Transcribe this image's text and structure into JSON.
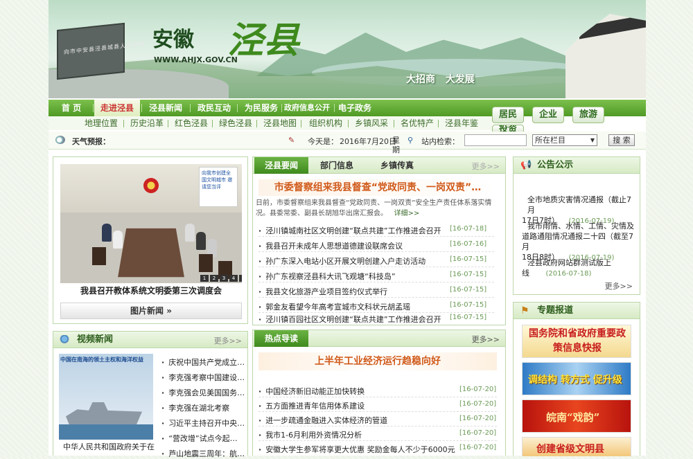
{
  "banner": {
    "title_a": "安徽",
    "title_b": "泾县",
    "url": "WWW.AHJX.GOV.CN",
    "slogan": "大招商 大发展",
    "monument_text": "向市中安县泾县城县人民政府"
  },
  "nav": {
    "main": [
      "首 页",
      "走进泾县",
      "泾县新闻",
      "政民互动",
      "为民服务",
      "政府信息公开",
      "电子政务"
    ],
    "current": "走进泾县",
    "sub": [
      "地理位置",
      "历史沿革",
      "红色泾县",
      "绿色泾县",
      "泾县地图",
      "组织机构",
      "乡镇风采",
      "名优特产",
      "泾县年鉴"
    ],
    "buttons": [
      "居民",
      "企业",
      "旅游",
      "投资"
    ]
  },
  "toolbar": {
    "weather_label": "天气预报：",
    "today_label": "今天是：",
    "date": "2016年7月20日",
    "weekday": "星期三",
    "search_label": "站内检索：",
    "search_scope": "所在栏目",
    "search_button": "搜 索"
  },
  "photo_news": {
    "wall_banner": "向我市创建全国文明城市 邀请您当评",
    "caption": "我县召开教体系统文明委第三次调度会",
    "pages": [
      "1",
      "2",
      "3",
      "4",
      "5"
    ],
    "button": "图片新闻"
  },
  "video": {
    "title": "视频新闻",
    "more": "更多>>",
    "image_title": "中国在南海的领土主权和海洋权益",
    "image_caption": "中华人民共和国政府关于在",
    "items": [
      "庆祝中国共产党成立…",
      "李克强考察中国建设…",
      "李克强会见美国国务…",
      "李克强在湖北考察",
      "习近平主持召开中央…",
      "“营改增”试点今起…",
      "芦山地震三周年：航…"
    ]
  },
  "news": {
    "tabs": [
      "泾县要闻",
      "部门信息",
      "乡镇传真"
    ],
    "more": "更多>>",
    "headline": "市委督察组来我县督查“党政同责、一岗双责”…",
    "summary": "日前，市委督察组来我县督查“党政同责、一岗双责”安全生产责任体系落实情况。县委常委、副县长胡旭华出席汇报会。",
    "detail": "详细>>",
    "items": [
      {
        "title": "泾川镇城南社区文明创建“联点共建”工作推进会召开",
        "date": "[16-07-18]"
      },
      {
        "title": "我县召开未成年人思想道德建设联席会议",
        "date": "[16-07-16]"
      },
      {
        "title": "孙广东深入电站小区开展文明创建入户走访活动",
        "date": "[16-07-15]"
      },
      {
        "title": "孙广东视察泾县科大讯飞观塘“科技岛”",
        "date": "[16-07-15]"
      },
      {
        "title": "我县文化旅游产业项目签约仪式举行",
        "date": "[16-07-15]"
      },
      {
        "title": "郭金友看望今年高考宣城市文科状元胡孟瑶",
        "date": "[16-07-15]"
      },
      {
        "title": "泾川镇百园社区文明创建“联点共建”工作推进会召开",
        "date": "[16-07-15]"
      }
    ]
  },
  "hot": {
    "title": "热点导读",
    "more": "更多>>",
    "headline": "上半年工业经济运行趋稳向好",
    "items": [
      {
        "title": "中国经济新旧动能正加快转换",
        "date": "[16-07-20]"
      },
      {
        "title": "五方面推进青年信用体系建设",
        "date": "[16-07-20]"
      },
      {
        "title": "进一步疏通金融进入实体经济的管道",
        "date": "[16-07-20]"
      },
      {
        "title": "我市1-6月利用外资情况分析",
        "date": "[16-07-20]"
      },
      {
        "title": "安徽大学生参军将享更大优惠 奖励金每人不少于6000元",
        "date": "[16-07-20]"
      }
    ]
  },
  "notice": {
    "title": "公告公示",
    "more": "更多>>",
    "items": [
      {
        "lines": [
          "全市地质灾害情况通报（截止7月",
          "17日7时）"
        ],
        "date": "(2016-07-19)"
      },
      {
        "lines": [
          "我市雨情、水情、工情、灾情及",
          "道路通阻情况通报二十四（截至7月",
          "18日8时）"
        ],
        "date": "(2016-07-19)"
      },
      {
        "lines": [
          "泾县政府网站群测试版上",
          "线"
        ],
        "date": "(2016-07-18)"
      }
    ]
  },
  "special": {
    "title": "专题报道",
    "items": [
      "国务院和省政府重要政策信息快报",
      "调结构 转方式 促升级",
      "皖南“戏韵”",
      "创建省级文明县"
    ]
  }
}
